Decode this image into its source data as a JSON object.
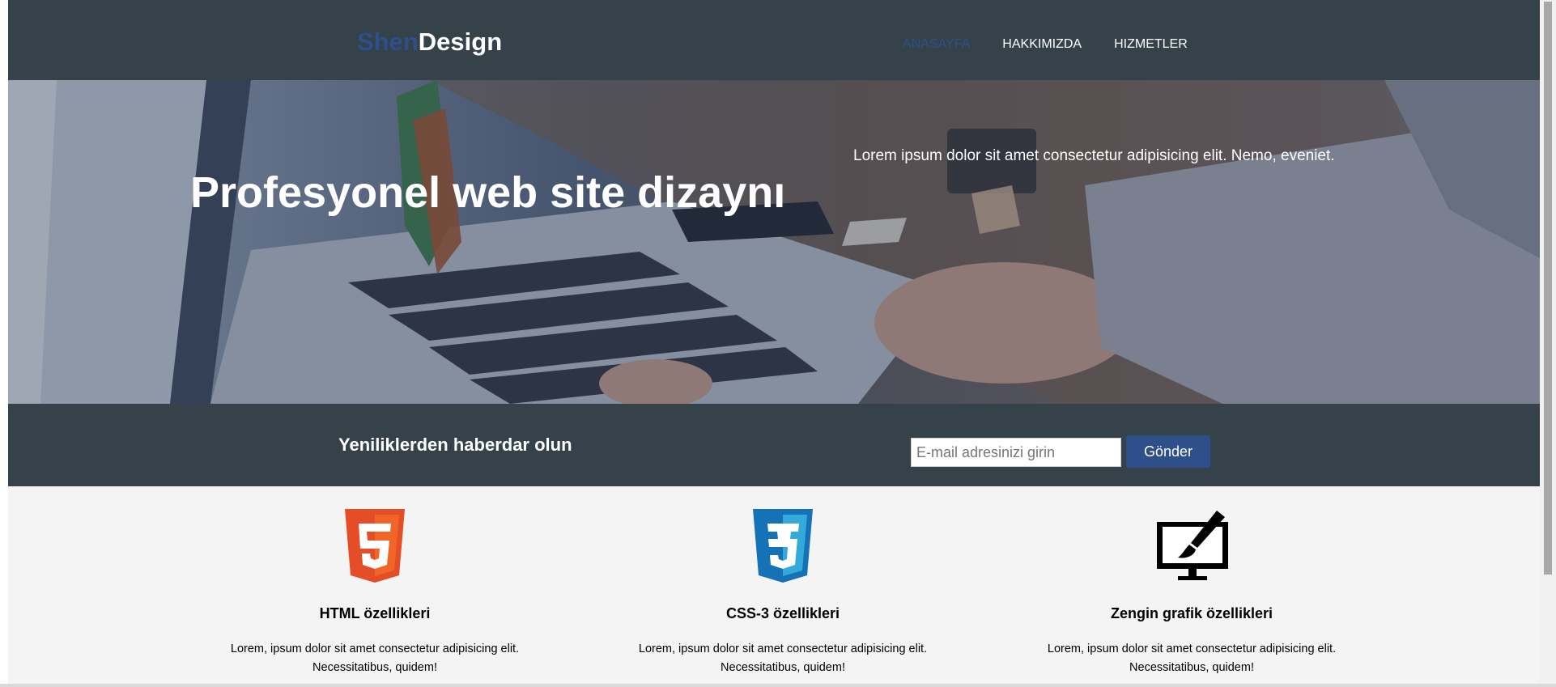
{
  "header": {
    "logo_accent": "Shen",
    "logo_main": "Design",
    "nav": [
      {
        "label": "ANASAYFA",
        "active": true
      },
      {
        "label": "HAKKIMIZDA",
        "active": false
      },
      {
        "label": "HIZMETLER",
        "active": false
      }
    ]
  },
  "hero": {
    "title": "Profesyonel web site dizaynı",
    "text": "Lorem ipsum dolor sit amet consectetur adipisicing elit. Nemo, eveniet."
  },
  "newsletter": {
    "title": "Yeniliklerden haberdar olun",
    "email_placeholder": "E-mail adresinizi girin",
    "email_value": "",
    "button_label": "Gönder"
  },
  "features": [
    {
      "icon": "html5-icon",
      "title": "HTML özellikleri",
      "text_line1": "Lorem, ipsum dolor sit amet consectetur adipisicing elit.",
      "text_line2": "Necessitatibus, quidem!"
    },
    {
      "icon": "css3-icon",
      "title": "CSS-3 özellikleri",
      "text_line1": "Lorem, ipsum dolor sit amet consectetur adipisicing elit.",
      "text_line2": "Necessitatibus, quidem!"
    },
    {
      "icon": "graphic-design-icon",
      "title": "Zengin grafik özellikleri",
      "text_line1": "Lorem, ipsum dolor sit amet consectetur adipisicing elit.",
      "text_line2": "Necessitatibus, quidem!"
    }
  ],
  "colors": {
    "header_bg": "#35424a",
    "accent": "#2e4f8a",
    "page_bg": "#f4f4f4",
    "html5_orange": "#e44d26",
    "css3_blue": "#1572b6"
  }
}
